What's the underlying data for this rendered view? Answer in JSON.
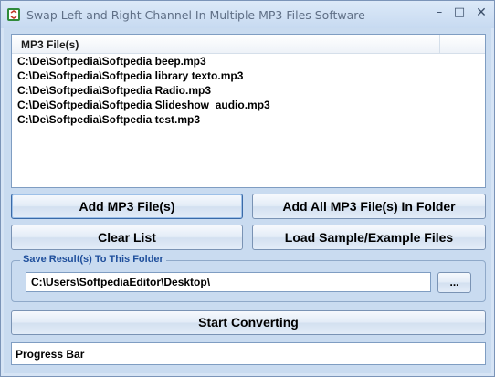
{
  "window": {
    "title": "Swap Left and Right Channel In Multiple MP3 Files Software",
    "controls": {
      "minimize": "–",
      "maximize": "□",
      "close": "✕"
    }
  },
  "file_list": {
    "column_header": "MP3 File(s)",
    "rows": [
      "C:\\De\\Softpedia\\Softpedia beep.mp3",
      "C:\\De\\Softpedia\\Softpedia library texto.mp3",
      "C:\\De\\Softpedia\\Softpedia Radio.mp3",
      "C:\\De\\Softpedia\\Softpedia Slideshow_audio.mp3",
      "C:\\De\\Softpedia\\Softpedia test.mp3"
    ]
  },
  "buttons": {
    "add_files": "Add MP3 File(s)",
    "add_folder": "Add All MP3 File(s) In Folder",
    "clear_list": "Clear List",
    "load_samples": "Load Sample/Example Files",
    "browse": "...",
    "start": "Start Converting"
  },
  "output": {
    "group_label": "Save Result(s) To This Folder",
    "folder_value": "C:\\Users\\SoftpediaEditor\\Desktop\\"
  },
  "progress": {
    "label": "Progress Bar",
    "value": 0
  },
  "colors": {
    "accent": "#1f4f9c",
    "window_bg": "#c9dbf0"
  }
}
